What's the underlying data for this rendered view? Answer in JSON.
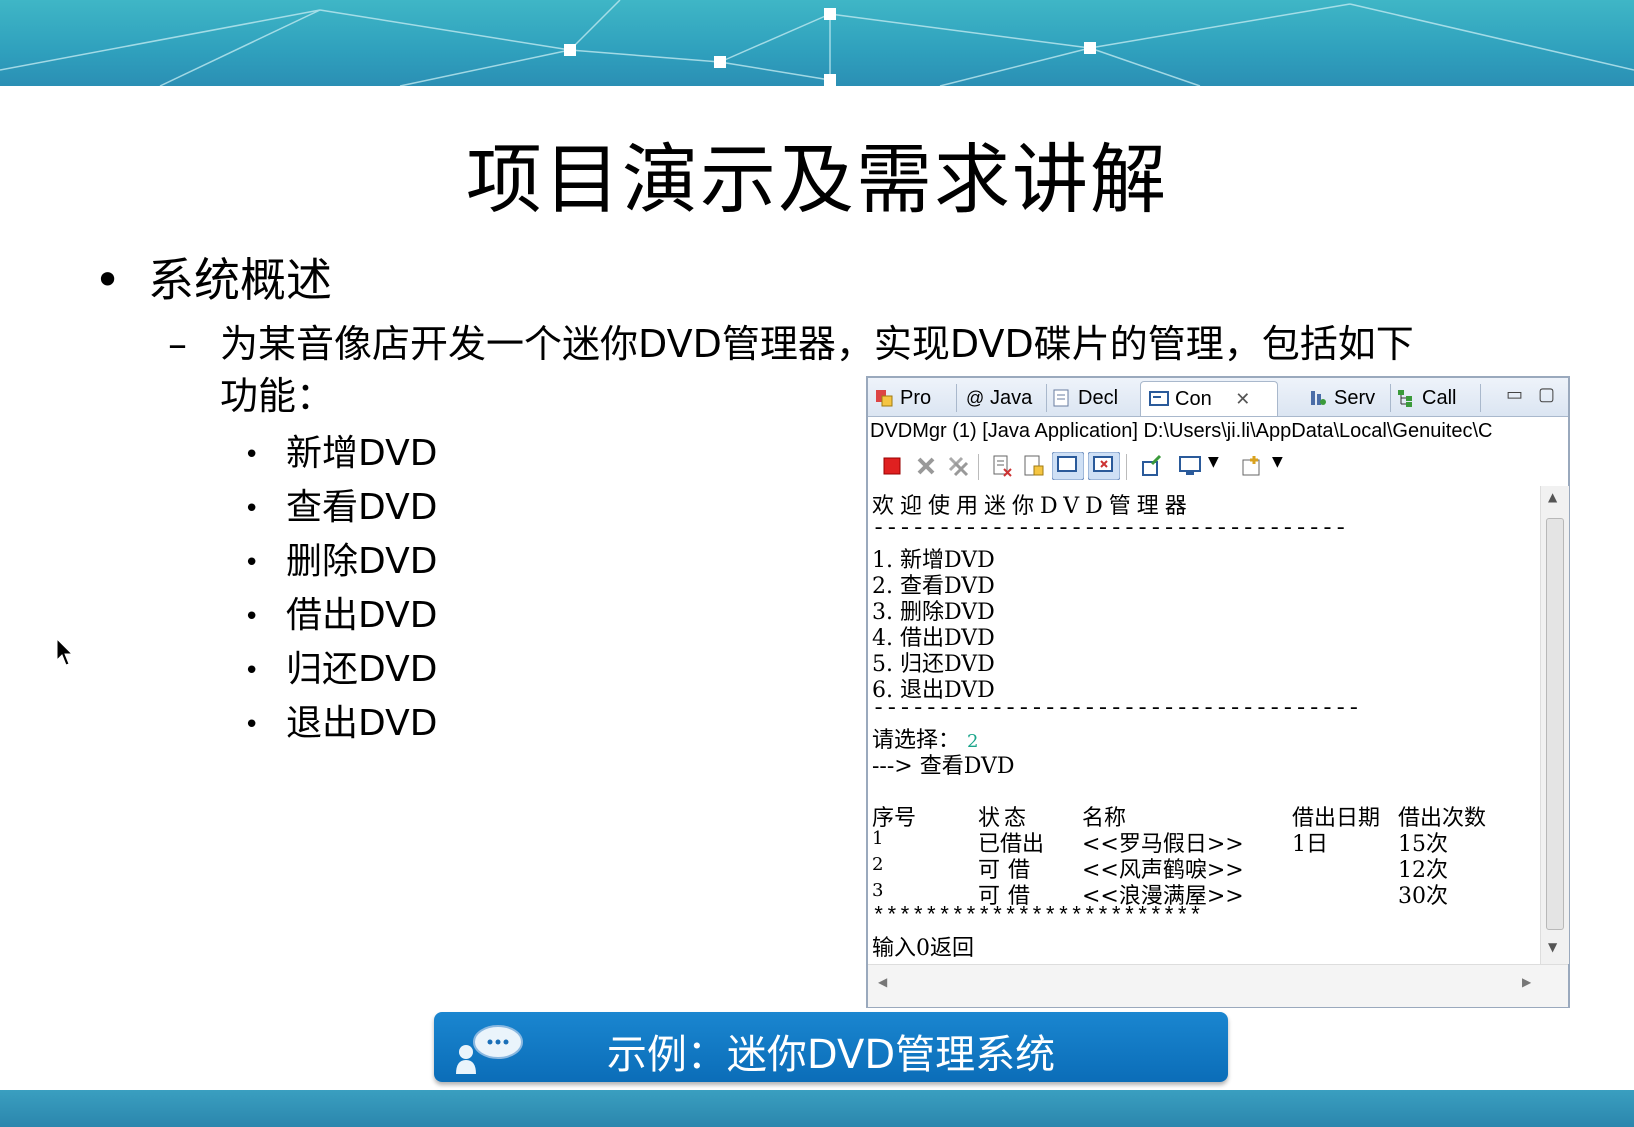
{
  "slide": {
    "title": "项目演示及需求讲解",
    "bullet1": "系统概述",
    "bullet2_line1": "为某音像店开发一个迷你DVD管理器，实现DVD碟片的管理，包括如下",
    "bullet2_line2": "功能：",
    "features": [
      "新增DVD",
      "查看DVD",
      "删除DVD",
      "借出DVD",
      "归还DVD",
      "退出DVD"
    ],
    "caption": "示例：迷你DVD管理系统"
  },
  "eclipse": {
    "tabs": [
      "Pro",
      "Java",
      "Decl",
      "Con",
      "Serv",
      "Call"
    ],
    "path": "DVDMgr (1) [Java Application] D:\\Users\\ji.li\\AppData\\Local\\Genuitec\\C",
    "console": {
      "welcome": "欢迎使用迷你DVD管理器",
      "sep1": "------------------------------------",
      "menu": [
        "1. 新增DVD",
        "2. 查看DVD",
        "3. 删除DVD",
        "4. 借出DVD",
        "5. 归还DVD",
        "6. 退出DVD"
      ],
      "sep2": "-------------------------------------",
      "prompt": "请选择：",
      "input": "2",
      "arrow": "---> 查看DVD",
      "headers": [
        "序号",
        "状态",
        "名称",
        "借出日期",
        "借出次数"
      ],
      "rows": [
        [
          "1",
          "已借出",
          "<<罗马假日>>",
          "1日",
          "15次"
        ],
        [
          "2",
          "可借",
          "<<风声鹤唳>>",
          "",
          "12次"
        ],
        [
          "3",
          "可借",
          "<<浪漫满屋>>",
          "",
          "30次"
        ]
      ],
      "stars": "*************************",
      "footer": "输入0返回"
    }
  },
  "colors": {
    "banner": "#2fa0bd",
    "caption": "#0b6db8",
    "input_green": "#1aa58a"
  }
}
